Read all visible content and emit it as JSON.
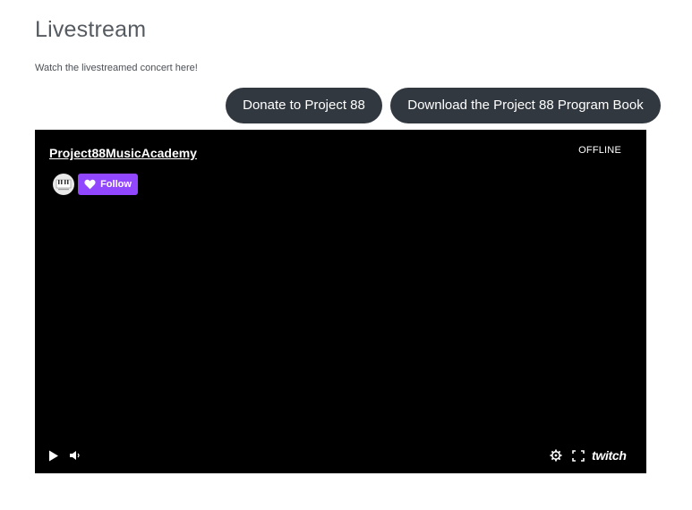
{
  "page": {
    "title": "Livestream",
    "subtitle": "Watch the livestreamed concert here!"
  },
  "buttons": {
    "donate_label": "Donate to Project 88",
    "download_label": "Download the Project 88 Program Book"
  },
  "player": {
    "channel_name": "Project88MusicAcademy",
    "status": "OFFLINE",
    "follow_label": "Follow",
    "logo_text": "twitch",
    "icons": [
      "play-icon",
      "volume-icon",
      "settings-icon",
      "fullscreen-icon",
      "heart-icon"
    ],
    "colors": {
      "background": "#000000",
      "follow_button": "#9147ff",
      "page_buttons": "#323840"
    }
  }
}
